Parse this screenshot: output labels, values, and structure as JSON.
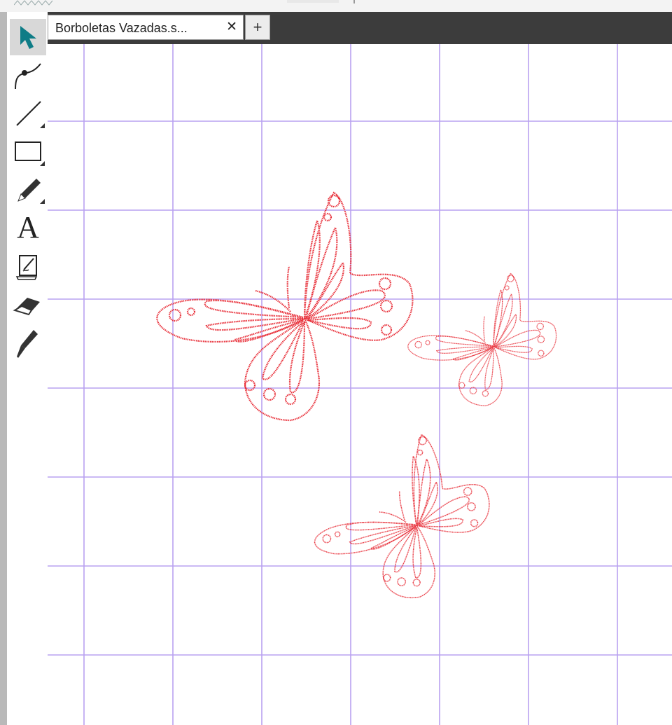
{
  "tabs": [
    {
      "title": "Borboletas Vazadas.s...",
      "close_label": "✕"
    }
  ],
  "add_tab_label": "+",
  "tools": [
    {
      "name": "select-tool",
      "icon": "arrow-pointer-icon",
      "active": true
    },
    {
      "name": "edit-points-tool",
      "icon": "bezier-node-icon"
    },
    {
      "name": "line-tool",
      "icon": "line-icon"
    },
    {
      "name": "rectangle-tool",
      "icon": "rectangle-icon"
    },
    {
      "name": "draw-tool",
      "icon": "pencil-icon"
    },
    {
      "name": "text-tool",
      "icon": "text-icon",
      "label": "A"
    },
    {
      "name": "sketch-tool",
      "icon": "sketch-pad-icon"
    },
    {
      "name": "eraser-tool",
      "icon": "eraser-icon"
    },
    {
      "name": "knife-tool",
      "icon": "knife-icon"
    }
  ],
  "colors": {
    "accent": "#0e7c86",
    "grid": "#b9a2f0",
    "cut_line": "#e8303a",
    "tabbar": "#3c3c3c"
  },
  "canvas": {
    "designs": [
      "butterfly-large",
      "butterfly-right",
      "butterfly-bottom"
    ]
  }
}
